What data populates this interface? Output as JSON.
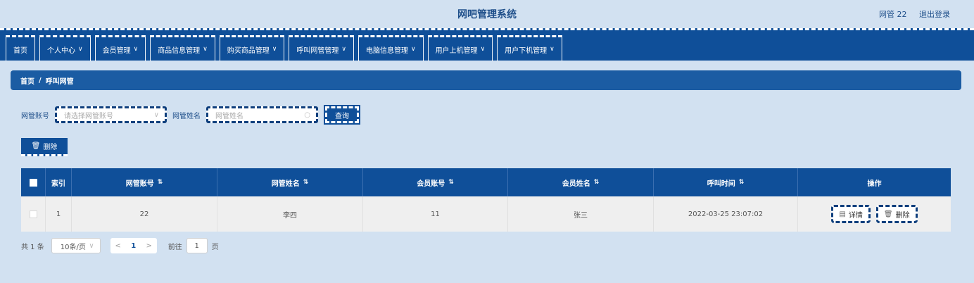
{
  "header": {
    "title": "网吧管理系统",
    "user": "网管 22",
    "logout": "退出登录"
  },
  "nav": [
    {
      "label": "首页",
      "dropdown": false
    },
    {
      "label": "个人中心",
      "dropdown": true
    },
    {
      "label": "会员管理",
      "dropdown": true
    },
    {
      "label": "商品信息管理",
      "dropdown": true
    },
    {
      "label": "购买商品管理",
      "dropdown": true
    },
    {
      "label": "呼叫网管管理",
      "dropdown": true
    },
    {
      "label": "电脑信息管理",
      "dropdown": true
    },
    {
      "label": "用户上机管理",
      "dropdown": true
    },
    {
      "label": "用户下机管理",
      "dropdown": true
    }
  ],
  "breadcrumb": {
    "home": "首页",
    "sep": "/",
    "current": "呼叫网管"
  },
  "search": {
    "account_label": "网管账号",
    "account_placeholder": "请选择网管账号",
    "name_label": "网管姓名",
    "name_placeholder": "网管姓名",
    "query_button": "查询"
  },
  "toolbar": {
    "delete_button": "删除"
  },
  "table": {
    "headers": [
      "索引",
      "网管账号",
      "网管姓名",
      "会员账号",
      "会员姓名",
      "呼叫时间",
      "操作"
    ],
    "rows": [
      {
        "index": "1",
        "admin_account": "22",
        "admin_name": "李四",
        "member_account": "11",
        "member_name": "张三",
        "call_time": "2022-03-25 23:07:02"
      }
    ],
    "actions": {
      "detail": "详情",
      "delete": "删除"
    }
  },
  "pagination": {
    "total": "共 1 条",
    "page_size": "10条/页",
    "current_page": "1",
    "goto_label": "前往",
    "goto_value": "1",
    "page_suffix": "页"
  },
  "colors": {
    "primary": "#0f4f99",
    "background": "#d2e1f1",
    "header_text": "#1f4f8a"
  }
}
